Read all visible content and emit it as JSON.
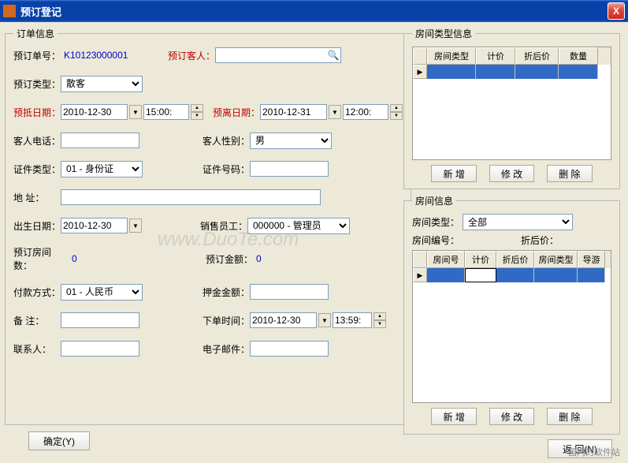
{
  "window": {
    "title": "预订登记",
    "close": "X"
  },
  "order_info": {
    "legend": "订单信息",
    "order_no_label": "预订单号：",
    "order_no_value": "K10123000001",
    "guest_label": "预订客人：",
    "guest_value": "",
    "booking_type_label": "预订类型：",
    "booking_type_value": "散客",
    "arrival_date_label": "预抵日期：",
    "arrival_date_value": "2010-12-30",
    "arrival_time_value": "15:00:",
    "departure_date_label": "预离日期：",
    "departure_date_value": "2010-12-31",
    "departure_time_value": "12:00:",
    "guest_phone_label": "客人电话：",
    "guest_phone_value": "",
    "guest_gender_label": "客人性别：",
    "guest_gender_value": "男",
    "id_type_label": "证件类型：",
    "id_type_value": "01 - 身份证",
    "id_number_label": "证件号码：",
    "id_number_value": "",
    "address_label": "地 址：",
    "address_value": "",
    "birth_date_label": "出生日期：",
    "birth_date_value": "2010-12-30",
    "sales_staff_label": "销售员工：",
    "sales_staff_value": "000000 - 管理员",
    "room_count_label": "预订房间数：",
    "room_count_value": "0",
    "booking_amount_label": "预订金额：",
    "booking_amount_value": "0",
    "payment_label": "付款方式：",
    "payment_value": "01 - 人民币",
    "deposit_label": "押金金额：",
    "deposit_value": "",
    "remark_label": "备 注：",
    "remark_value": "",
    "order_time_label": "下单时间：",
    "order_time_date": "2010-12-30",
    "order_time_time": "13:59:",
    "contact_label": "联系人：",
    "contact_value": "",
    "email_label": "电子邮件：",
    "email_value": "",
    "confirm_btn": "确定(Y)"
  },
  "room_type_info": {
    "legend": "房间类型信息",
    "columns": [
      "房间类型",
      "计价",
      "折后价",
      "数量"
    ],
    "add_btn": "新 增",
    "edit_btn": "修 改",
    "delete_btn": "删 除"
  },
  "room_info": {
    "legend": "房间信息",
    "room_type_filter_label": "房间类型：",
    "room_type_filter_value": "全部",
    "room_no_label": "房间编号：",
    "discount_label": "折后价：",
    "columns": [
      "房间号",
      "计价",
      "折后价",
      "房间类型",
      "导游"
    ],
    "add_btn": "新 增",
    "edit_btn": "修 改",
    "delete_btn": "删 除",
    "return_btn": "返 回(N)"
  },
  "watermark": "www.DuoTe.com",
  "footer_text": "国内的软件站"
}
